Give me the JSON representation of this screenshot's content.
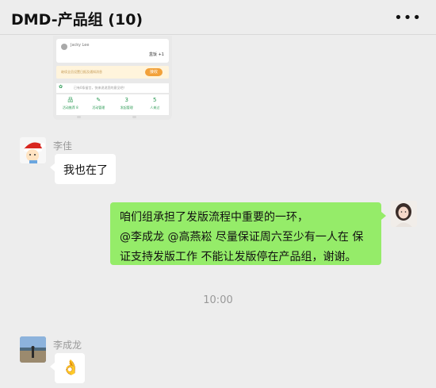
{
  "header": {
    "title": "DMD-产品组 (10)",
    "more_icon": "•••"
  },
  "shared_screenshot": {
    "user_name": "Jacky Lee",
    "food_item": "盒饭 +1",
    "reminder_text": "继续全员设置日报及通知消息",
    "reminder_button": "接收",
    "notice_text": "已有0条留言，快来说说您的意见吧！",
    "stats": [
      {
        "icon": "品",
        "label": "活动推荐 8"
      },
      {
        "icon": "✎",
        "label": "活动管理"
      },
      {
        "icon": "3",
        "label": "发起管理"
      },
      {
        "icon": "5",
        "label": "人来过"
      }
    ]
  },
  "messages": [
    {
      "sender": "李佳",
      "text": "我也在了"
    },
    {
      "sender": "me",
      "lines": [
        "咱们组承担了发版流程中重要的一环，",
        "@李成龙 @高燕崧  尽量保证周六至少有一人在 保",
        "证支持发版工作 不能让发版停在产品组，谢谢。"
      ]
    },
    {
      "time": "10:00"
    },
    {
      "sender": "李成龙",
      "emoji": "👌"
    }
  ],
  "colors": {
    "background": "#ededed",
    "sent_bubble": "#95ec69",
    "received_bubble": "#ffffff",
    "accent_green": "#2b9a54"
  }
}
